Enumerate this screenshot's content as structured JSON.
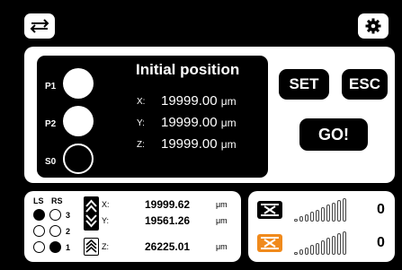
{
  "toolbar": {
    "swap_icon": "swap-arrows-icon",
    "settings_icon": "gear-icon"
  },
  "presets": [
    {
      "label": "P1",
      "filled": true
    },
    {
      "label": "P2",
      "filled": true
    },
    {
      "label": "S0",
      "filled": false
    }
  ],
  "position": {
    "title": "Initial position",
    "unit": "μm",
    "axes": [
      {
        "axis": "X:",
        "value": "19999.00"
      },
      {
        "axis": "Y:",
        "value": "19999.00"
      },
      {
        "axis": "Z:",
        "value": "19999.00"
      }
    ]
  },
  "buttons": {
    "set": "SET",
    "esc": "ESC",
    "go": "GO!"
  },
  "switches": {
    "ls_label": "LS",
    "rs_label": "RS",
    "rows": [
      {
        "num": "3",
        "ls": true,
        "rs": false
      },
      {
        "num": "2",
        "ls": false,
        "rs": false
      },
      {
        "num": "1",
        "ls": false,
        "rs": true
      }
    ]
  },
  "encoders": {
    "unit": "μm",
    "x": {
      "label": "X:",
      "value": "19999.62"
    },
    "y": {
      "label": "Y:",
      "value": "19561.26"
    },
    "z": {
      "label": "Z:",
      "value": "26225.01"
    }
  },
  "speed": {
    "rows": [
      {
        "icon": "motor-speed-icon",
        "value": "0",
        "color": "#000000",
        "level": 0
      },
      {
        "icon": "spindle-speed-icon",
        "value": "0",
        "color": "#f08a1c",
        "level": 0
      }
    ],
    "bar_count": 10
  },
  "colors": {
    "background": "#000000",
    "panel": "#ffffff",
    "accent_orange": "#f08a1c"
  }
}
